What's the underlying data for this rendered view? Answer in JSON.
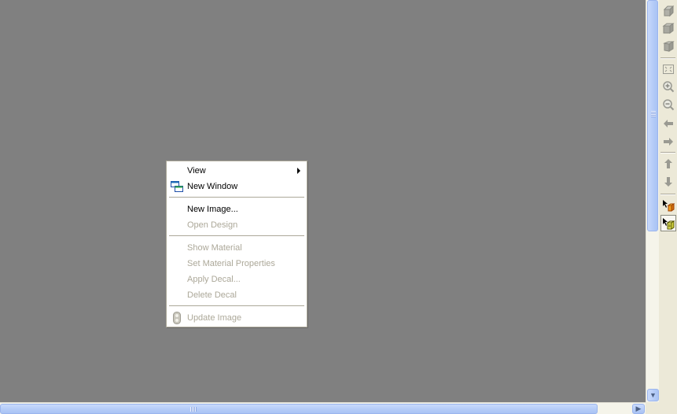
{
  "menu": {
    "view": "View",
    "new_window": "New Window",
    "new_image": "New Image...",
    "open_design": "Open Design",
    "show_material": "Show Material",
    "set_material_properties": "Set Material Properties",
    "apply_decal": "Apply Decal...",
    "delete_decal": "Delete Decal",
    "update_image": "Update Image"
  },
  "toolbar": {
    "icons": [
      "isometric-view-icon",
      "dimetric-view-icon",
      "trimetric-view-icon",
      "zoom-to-fit-icon",
      "zoom-in-icon",
      "zoom-out-icon",
      "pan-left-icon",
      "pan-right-icon",
      "pan-up-icon",
      "pan-down-icon",
      "select-part-icon",
      "select-face-icon"
    ]
  },
  "colors": {
    "canvas": "#808080",
    "menu_bg": "#ffffff",
    "disabled_text": "#aca899",
    "scrollbar_thumb": "#b6cdf8"
  }
}
